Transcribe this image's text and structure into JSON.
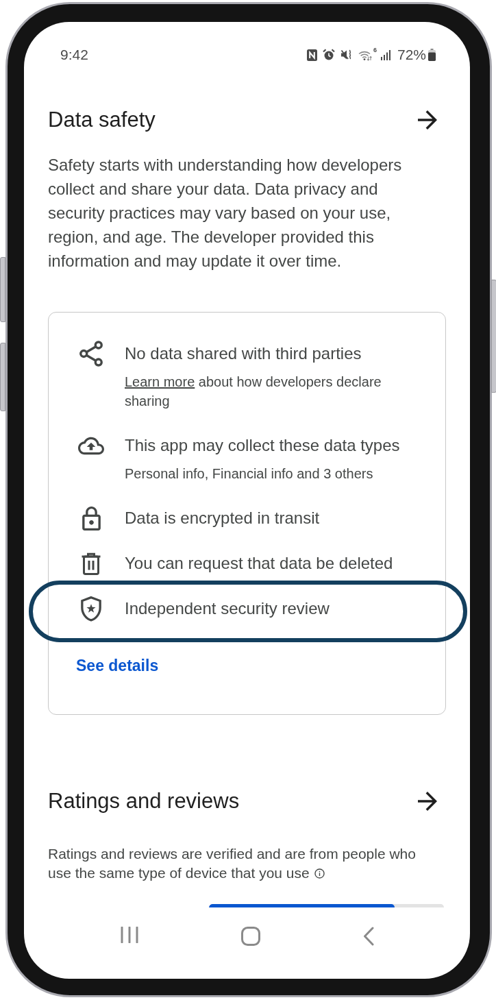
{
  "status_bar": {
    "time": "9:42",
    "wifi_label": "6",
    "battery": "72%"
  },
  "data_safety": {
    "title": "Data safety",
    "description": "Safety starts with understanding how developers collect and share your data. Data privacy and security practices may vary based on your use, region, and age. The developer provided this information and may update it over time.",
    "items": [
      {
        "kind": "sharing",
        "title": "No data shared with third parties",
        "link": "Learn more",
        "detail": "about how developers declare sharing",
        "highlighted": false
      },
      {
        "kind": "collection",
        "title": "This app may collect these data types",
        "detail": "Personal info, Financial info and 3 others",
        "highlighted": false
      },
      {
        "kind": "encryption",
        "title": "Data is encrypted in transit",
        "highlighted": false
      },
      {
        "kind": "deletion",
        "title": "You can request that data be deleted",
        "highlighted": false
      },
      {
        "kind": "review",
        "title": "Independent security review",
        "highlighted": true
      }
    ],
    "link": "See details"
  },
  "ratings": {
    "title": "Ratings and reviews",
    "description": "Ratings and reviews are verified and are from people who use the same type of device that you use",
    "bars": [
      {
        "level": 0.79
      }
    ]
  }
}
